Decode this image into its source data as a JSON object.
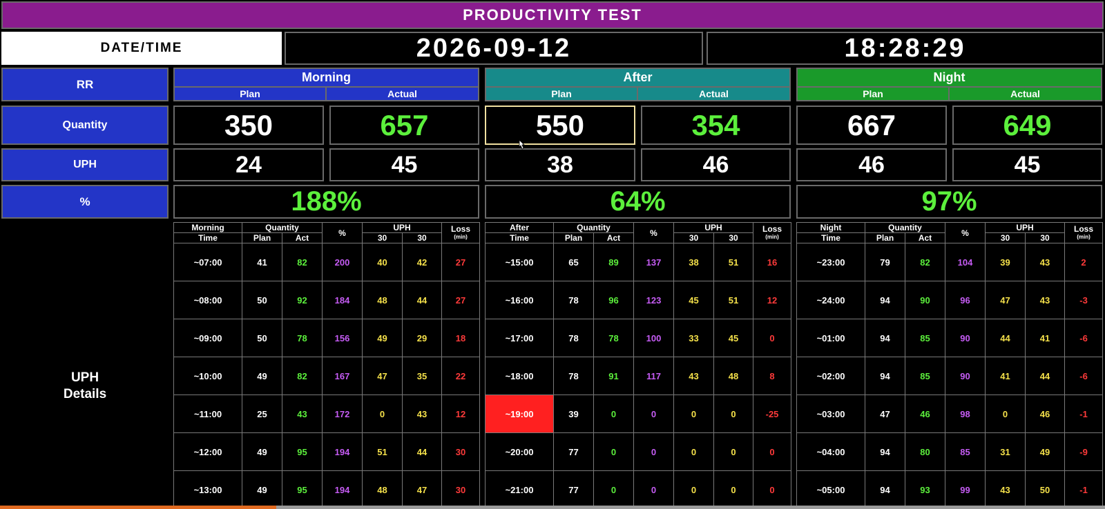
{
  "title": "PRODUCTIVITY TEST",
  "datetime": {
    "label": "DATE/TIME",
    "date": "2026-09-12",
    "time": "18:28:29"
  },
  "row_labels": {
    "rr": "RR",
    "quantity": "Quantity",
    "uph": "UPH",
    "percent": "%",
    "uph_details_1": "UPH",
    "uph_details_2": "Details"
  },
  "colors": {
    "morning": "#2335c7",
    "after": "#178a8a",
    "night": "#1a9a2a",
    "title": "#8a1c8e",
    "alert": "#ff2020"
  },
  "shifts": [
    {
      "name": "Morning",
      "plan_label": "Plan",
      "actual_label": "Actual",
      "qty_plan": "350",
      "qty_actual": "657",
      "uph_plan": "24",
      "uph_actual": "45",
      "percent": "188%",
      "detail": {
        "time_head": "Morning",
        "time_sub": "Time",
        "rows": [
          [
            "~07:00",
            "41",
            "82",
            "200",
            "40",
            "42",
            "27"
          ],
          [
            "~08:00",
            "50",
            "92",
            "184",
            "48",
            "44",
            "27"
          ],
          [
            "~09:00",
            "50",
            "78",
            "156",
            "49",
            "29",
            "18"
          ],
          [
            "~10:00",
            "49",
            "82",
            "167",
            "47",
            "35",
            "22"
          ],
          [
            "~11:00",
            "25",
            "43",
            "172",
            "0",
            "43",
            "12"
          ],
          [
            "~12:00",
            "49",
            "95",
            "194",
            "51",
            "44",
            "30"
          ],
          [
            "~13:00",
            "49",
            "95",
            "194",
            "48",
            "47",
            "30"
          ]
        ]
      }
    },
    {
      "name": "After",
      "plan_label": "Plan",
      "actual_label": "Actual",
      "qty_plan": "550",
      "qty_actual": "354",
      "uph_plan": "38",
      "uph_actual": "46",
      "percent": "64%",
      "detail": {
        "time_head": "After",
        "time_sub": "Time",
        "rows": [
          [
            "~15:00",
            "65",
            "89",
            "137",
            "38",
            "51",
            "16"
          ],
          [
            "~16:00",
            "78",
            "96",
            "123",
            "45",
            "51",
            "12"
          ],
          [
            "~17:00",
            "78",
            "78",
            "100",
            "33",
            "45",
            "0"
          ],
          [
            "~18:00",
            "78",
            "91",
            "117",
            "43",
            "48",
            "8"
          ],
          [
            "~19:00",
            "39",
            "0",
            "0",
            "0",
            "0",
            "-25"
          ],
          [
            "~20:00",
            "77",
            "0",
            "0",
            "0",
            "0",
            "0"
          ],
          [
            "~21:00",
            "77",
            "0",
            "0",
            "0",
            "0",
            "0"
          ]
        ]
      }
    },
    {
      "name": "Night",
      "plan_label": "Plan",
      "actual_label": "Actual",
      "qty_plan": "667",
      "qty_actual": "649",
      "uph_plan": "46",
      "uph_actual": "45",
      "percent": "97%",
      "detail": {
        "time_head": "Night",
        "time_sub": "Time",
        "rows": [
          [
            "~23:00",
            "79",
            "82",
            "104",
            "39",
            "43",
            "2"
          ],
          [
            "~24:00",
            "94",
            "90",
            "96",
            "47",
            "43",
            "-3"
          ],
          [
            "~01:00",
            "94",
            "85",
            "90",
            "44",
            "41",
            "-6"
          ],
          [
            "~02:00",
            "94",
            "85",
            "90",
            "41",
            "44",
            "-6"
          ],
          [
            "~03:00",
            "47",
            "46",
            "98",
            "0",
            "46",
            "-1"
          ],
          [
            "~04:00",
            "94",
            "80",
            "85",
            "31",
            "49",
            "-9"
          ],
          [
            "~05:00",
            "94",
            "93",
            "99",
            "43",
            "50",
            "-1"
          ]
        ]
      }
    }
  ],
  "detail_headers": {
    "quantity": "Quantity",
    "plan": "Plan",
    "act": "Act",
    "percent": "%",
    "uph": "UPH",
    "uph_30a": "30",
    "uph_30b": "30",
    "loss": "Loss",
    "loss_unit": "(min)"
  },
  "highlight": {
    "shift": 1,
    "row": 4
  },
  "bottom_progress": 0.25
}
